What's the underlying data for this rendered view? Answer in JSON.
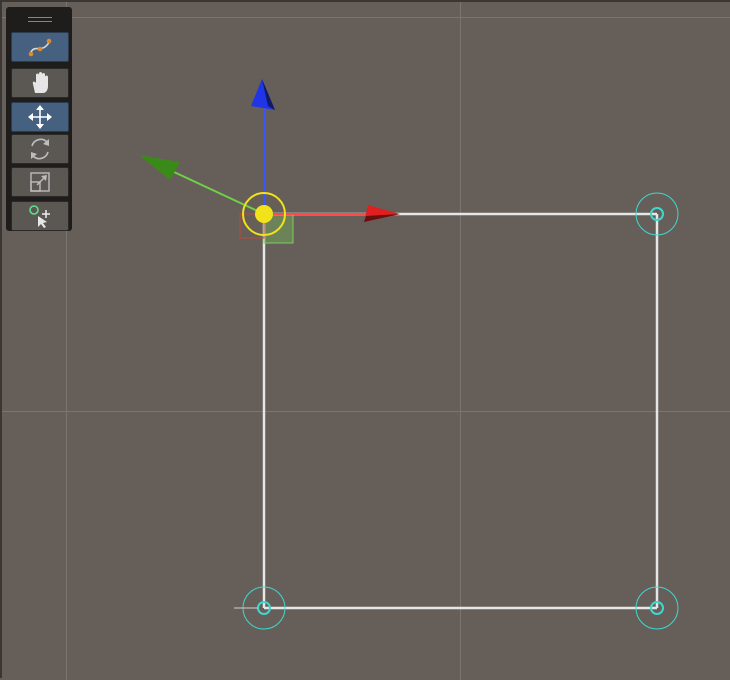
{
  "viewport": {
    "background": "#665f59",
    "grid_color": "#7b7570"
  },
  "toolbar": {
    "tools": [
      {
        "id": "edit-path",
        "icon": "spline-edit-icon",
        "active": true
      },
      {
        "id": "pan",
        "icon": "hand-icon",
        "active": false
      },
      {
        "id": "move",
        "icon": "move-icon",
        "active": true
      },
      {
        "id": "rotate",
        "icon": "rotate-icon",
        "active": false
      },
      {
        "id": "scale",
        "icon": "scale-icon",
        "active": false
      },
      {
        "id": "add-point",
        "icon": "add-point-icon",
        "active": false
      }
    ]
  },
  "gizmo": {
    "x_axis_color": "#e02020",
    "y_axis_color": "#2a3fe0",
    "z_axis_color": "#3a8a1a",
    "center_color": "#f2e21a"
  },
  "spline": {
    "line_color": "#e6e6e6",
    "point_color": "#3ed7d0"
  }
}
